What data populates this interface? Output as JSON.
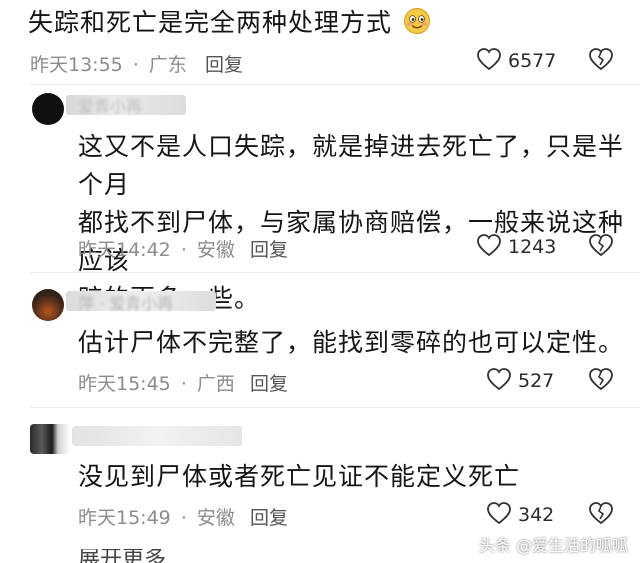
{
  "top_comment": {
    "text": "失踪和死亡是完全两种处理方式",
    "emoji": "smile-emoji",
    "time": "昨天13:55",
    "location": "广东",
    "reply_label": "回复",
    "likes": "6577"
  },
  "replies": [
    {
      "author_partial": "爱青小再",
      "text_lines": [
        "这又不是人口失踪，就是掉进去死亡了，只是半个月",
        "都找不到尸体，与家属协商赔偿，一般来说这种应该",
        "赔的更多一些。"
      ],
      "time": "昨天14:42",
      "location": "安徽",
      "reply_label": "回复",
      "likes": "1243"
    },
    {
      "author_partial": "萍 · 爱青小再",
      "text_lines": [
        "估计尸体不完整了，能找到零碎的也可以定性。"
      ],
      "time": "昨天15:45",
      "location": "广西",
      "reply_label": "回复",
      "likes": "527"
    },
    {
      "author_partial": "",
      "text_lines": [
        "没见到尸体或者死亡见证不能定义死亡"
      ],
      "time": "昨天15:49",
      "location": "安徽",
      "reply_label": "回复",
      "likes": "342"
    }
  ],
  "separator": "·",
  "more_partial": "展开更多",
  "watermark": "头条 @爱生活的呱呱",
  "colors": {
    "text": "#161616",
    "meta": "#8c8c8c",
    "bg": "#ffffff"
  }
}
